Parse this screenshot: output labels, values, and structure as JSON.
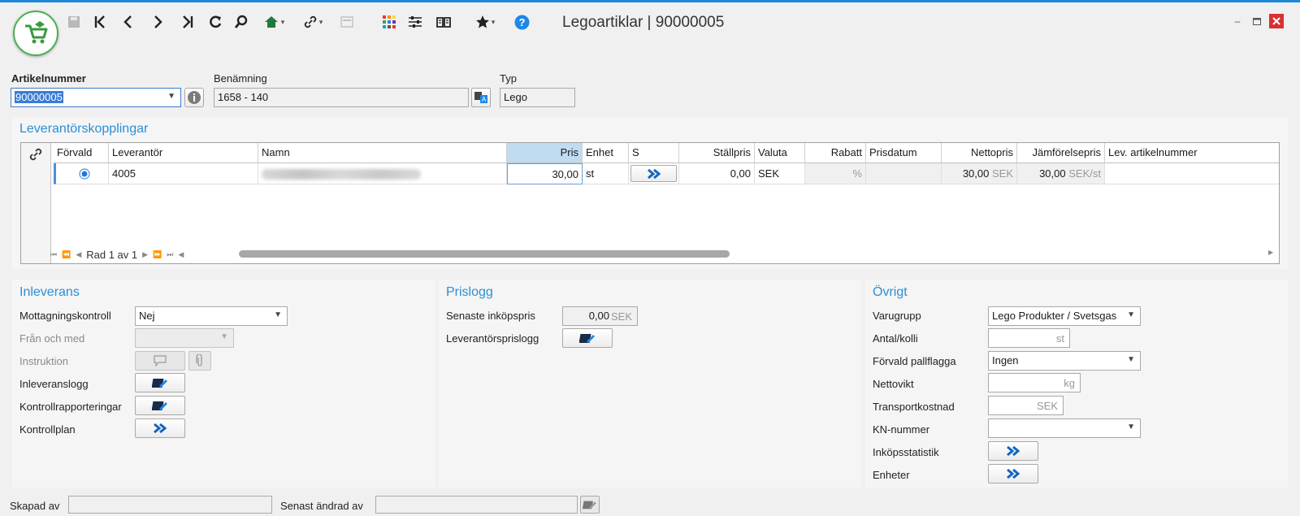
{
  "window": {
    "title": "Legoartiklar | 90000005",
    "minimize_icon": "minimize-icon",
    "maximize_icon": "maximize-icon",
    "close_icon": "close-icon"
  },
  "toolbar": {
    "icons": [
      "save-icon",
      "first-record-icon",
      "previous-icon",
      "next-icon",
      "last-record-icon",
      "refresh-icon",
      "search-icon",
      "home-icon",
      "link-icon",
      "window-icon",
      "apps-grid-icon",
      "settings-sliders-icon",
      "book-icon",
      "star-icon",
      "help-icon"
    ]
  },
  "header": {
    "article_number_label": "Artikelnummer",
    "article_number_value": "90000005",
    "name_label": "Benämning",
    "name_value": "1658 - 140",
    "type_label": "Typ",
    "type_value": "Lego"
  },
  "suppliers": {
    "title": "Leverantörskopplingar",
    "columns": [
      "Förvald",
      "Leverantör",
      "Namn",
      "Pris",
      "Enhet",
      "S",
      "Ställpris",
      "Valuta",
      "Rabatt",
      "Prisdatum",
      "Nettopris",
      "Jämförelsepris",
      "Lev. artikelnummer"
    ],
    "row": {
      "supplier": "4005",
      "price": "30,00",
      "unit": "st",
      "setup_price": "0,00",
      "currency": "SEK",
      "discount_unit": "%",
      "net_price": "30,00",
      "net_price_unit": "SEK",
      "compare_price": "30,00",
      "compare_price_unit": "SEK/st"
    },
    "pager_text": "Rad 1 av 1"
  },
  "inleverans": {
    "title": "Inleverans",
    "receipt_control_label": "Mottagningskontroll",
    "receipt_control_value": "Nej",
    "from_label": "Från och med",
    "instruction_label": "Instruktion",
    "delivery_log_label": "Inleveranslogg",
    "control_reports_label": "Kontrollrapporteringar",
    "control_plan_label": "Kontrollplan"
  },
  "prislogg": {
    "title": "Prislogg",
    "last_price_label": "Senaste inköpspris",
    "last_price_value": "0,00",
    "last_price_unit": "SEK",
    "supplier_price_log_label": "Leverantörsprislogg"
  },
  "ovrigt": {
    "title": "Övrigt",
    "product_group_label": "Varugrupp",
    "product_group_value": "Lego Produkter / Svetsgas",
    "qty_per_package_label": "Antal/kolli",
    "qty_per_package_unit": "st",
    "pallet_flag_label": "Förvald pallflagga",
    "pallet_flag_value": "Ingen",
    "net_weight_label": "Nettovikt",
    "net_weight_unit": "kg",
    "transport_cost_label": "Transportkostnad",
    "transport_cost_unit": "SEK",
    "kn_number_label": "KN-nummer",
    "purchase_stats_label": "Inköpsstatistik",
    "units_label": "Enheter"
  },
  "footer": {
    "created_by_label": "Skapad av",
    "modified_by_label": "Senast ändrad av"
  },
  "colors": {
    "accent": "#2a8fd6",
    "topline": "#1e88d9",
    "close": "#d9302f",
    "logo_green": "#4caf50"
  }
}
